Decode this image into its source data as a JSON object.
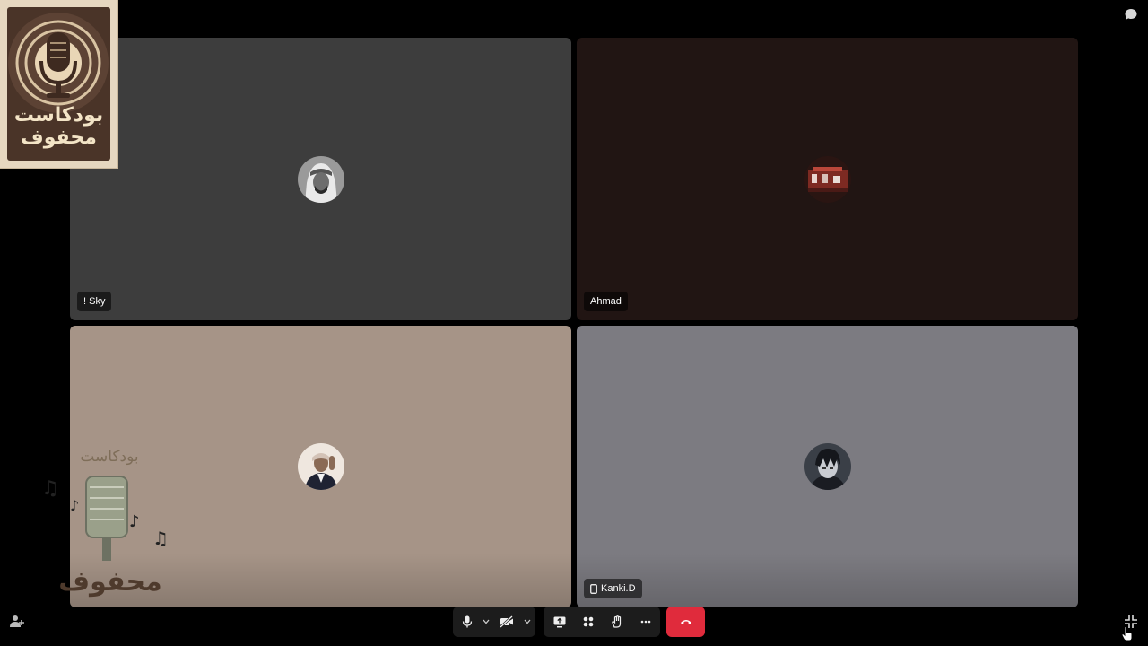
{
  "participants": [
    {
      "name": "! Sky",
      "background": "#3d3d3d",
      "avatar": "avatar-man-headdress",
      "mobile": false
    },
    {
      "name": "Ahmad",
      "background": "#211513",
      "avatar": "avatar-red-image",
      "mobile": false
    },
    {
      "name": "",
      "background": "#a69487",
      "avatar": "avatar-man-suit",
      "mobile": false
    },
    {
      "name": "Kanki.D",
      "background": "#7c7b81",
      "avatar": "avatar-anime-boy",
      "mobile": true
    }
  ],
  "podcast_logo": {
    "text_line1": "بودكاست",
    "text_line2": "محفوف"
  },
  "overlay_watermark": {
    "text_top": "بودكاست",
    "text_bottom": "محفوف"
  },
  "controls": {
    "items": [
      "microphone-icon",
      "chevron-down-icon",
      "camera-off-icon",
      "chevron-down-icon",
      "share-screen-icon",
      "apps-icon",
      "raise-hand-icon",
      "more-icon",
      "leave-call-icon"
    ],
    "leave_color": "#e02b3c"
  },
  "corner_icons": [
    "chat-icon",
    "participants-icon",
    "exit-fullscreen-icon"
  ]
}
